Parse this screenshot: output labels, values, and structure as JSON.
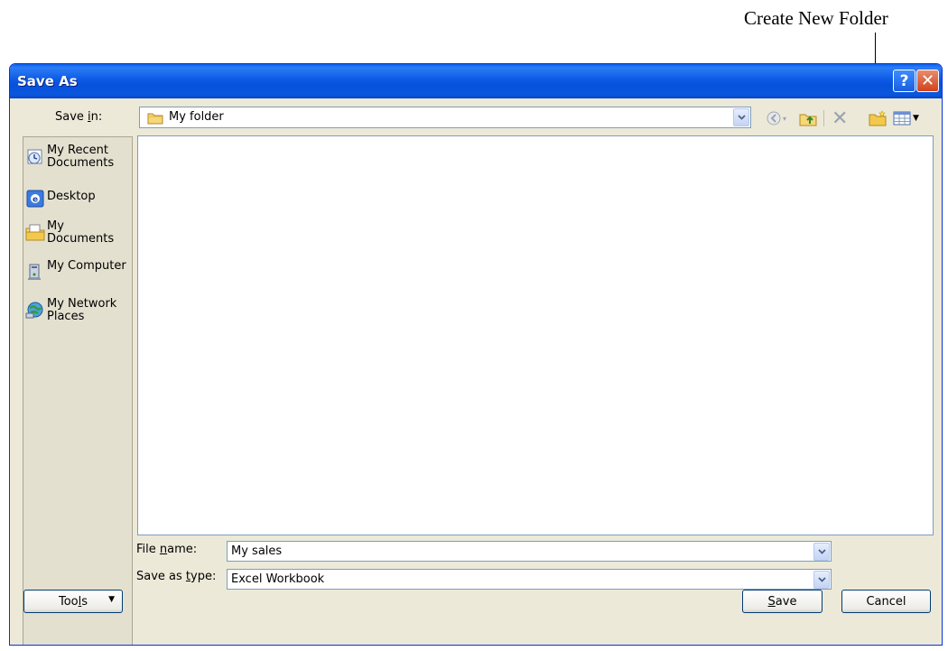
{
  "annotation": {
    "text": "Create New Folder"
  },
  "dialog": {
    "title": "Save As",
    "help_label": "?",
    "close_label": "✕"
  },
  "save_in": {
    "label_pre": "Save ",
    "label_key": "i",
    "label_post": "n:",
    "value": "My folder"
  },
  "places": [
    {
      "label": "My Recent Documents",
      "icon": "recent-documents-icon"
    },
    {
      "label": "Desktop",
      "icon": "desktop-icon"
    },
    {
      "label": "My Documents",
      "icon": "my-documents-icon"
    },
    {
      "label": "My Computer",
      "icon": "my-computer-icon"
    },
    {
      "label": "My Network Places",
      "icon": "network-places-icon"
    }
  ],
  "file_name": {
    "label_pre": "File ",
    "label_key": "n",
    "label_post": "ame:",
    "value": "My sales"
  },
  "save_as_type": {
    "label_pre": "Save as ",
    "label_key": "t",
    "label_post": "ype:",
    "value": "Excel Workbook"
  },
  "buttons": {
    "tools_pre": "Too",
    "tools_key": "l",
    "tools_post": "s",
    "save_key": "S",
    "save_post": "ave",
    "cancel": "Cancel"
  },
  "colors": {
    "title_bar": "#0a57dd",
    "window_bg": "#ece9d8",
    "border": "#7f9db9",
    "folder": "#f2c94c"
  }
}
